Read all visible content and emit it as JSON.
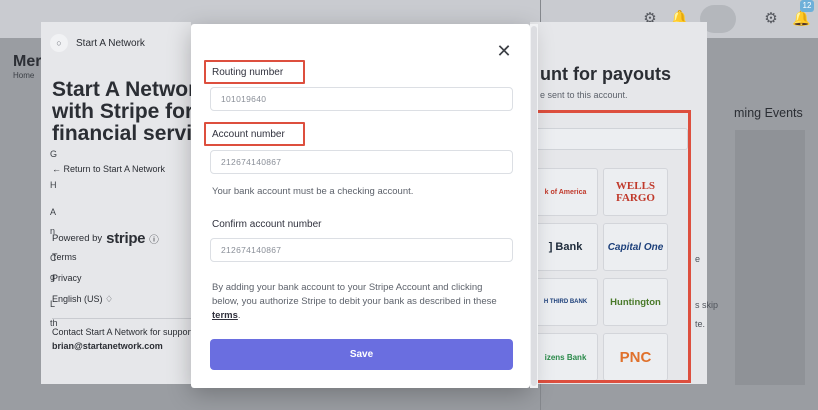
{
  "background": {
    "page_title": "Mer",
    "breadcrumb": "Home",
    "upcoming_events": "ming Events",
    "notification_count": "12",
    "side_letters": [
      "G",
      "H",
      "A",
      "n",
      "C",
      "g",
      "L",
      "th"
    ],
    "side_texts": [
      "e",
      "s skip",
      "te."
    ]
  },
  "stripe_page": {
    "brand_name": "Start A Network",
    "heading_lines": [
      "Start A Network",
      "with Stripe for",
      "financial servic"
    ],
    "return_link": "← Return to Start A Network",
    "powered_by": "Powered by",
    "stripe_word": "stripe",
    "links": [
      "Terms",
      "Privacy",
      "English (US) ♢"
    ],
    "contact_text": "Contact Start A Network for support",
    "contact_email": "brian@startanetwork.com",
    "right_heading": "unt for payouts",
    "right_subtext": "e sent to this account.",
    "banks": [
      {
        "name": "k of America",
        "color": "#c0392b"
      },
      {
        "name": "WELLS FARGO",
        "color": "#c0392b"
      },
      {
        "name": "] Bank",
        "color": "#1d2a3a"
      },
      {
        "name": "Capital One",
        "color": "#1c3f7a"
      },
      {
        "name": "H THIRD BANK",
        "color": "#1c3f7a"
      },
      {
        "name": "Huntington",
        "color": "#4a7a2a"
      },
      {
        "name": "izens Bank",
        "color": "#2a8a4a"
      },
      {
        "name": "PNC",
        "color": "#e0712c"
      }
    ]
  },
  "modal": {
    "close_label": "✕",
    "routing_label": "Routing number",
    "routing_value": "101019640",
    "account_label": "Account number",
    "account_value": "212674140867",
    "checking_note": "Your bank account must be a checking account.",
    "confirm_label": "Confirm account number",
    "confirm_value": "212674140867",
    "auth_text": "By adding your bank account to your Stripe Account and clicking below, you authorize Stripe to debit your bank as described in these ",
    "terms_link": "terms",
    "auth_end": ".",
    "save_label": "Save"
  },
  "colors": {
    "annotation_red": "#dd4f3e",
    "save_button": "#6a6ee0"
  }
}
